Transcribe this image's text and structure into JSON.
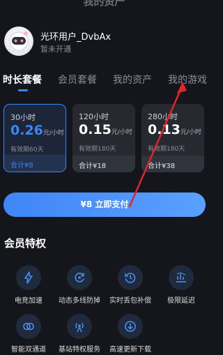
{
  "header": {
    "title": "我的资产"
  },
  "profile": {
    "name": "光环用户_DvbAx",
    "status": "暂未开通"
  },
  "tabs": [
    {
      "label": "时长套餐",
      "active": true
    },
    {
      "label": "会员套餐",
      "active": false
    },
    {
      "label": "我的资产",
      "active": false
    },
    {
      "label": "我的游戏",
      "active": false
    }
  ],
  "plans": [
    {
      "duration": "30小时",
      "price": "0.26",
      "unit": "元/小时",
      "validity": "有效期60天",
      "total": "合计¥8",
      "selected": true
    },
    {
      "duration": "120小时",
      "price": "0.15",
      "unit": "元/小时",
      "validity": "有效期180天",
      "total": "合计¥18",
      "selected": false
    },
    {
      "duration": "280小时",
      "price": "0.13",
      "unit": "元/小时",
      "validity": "有效期180天",
      "total": "合计¥38",
      "selected": false
    }
  ],
  "pay_button": {
    "label": "¥8 立即支付"
  },
  "perks_section": {
    "title": "会员特权",
    "items": [
      {
        "label": "电竞加速",
        "icon": "lightning-icon"
      },
      {
        "label": "动态多线防掉",
        "icon": "refresh-icon"
      },
      {
        "label": "实时丢包补偿",
        "icon": "clock-rewind-icon"
      },
      {
        "label": "极限延迟",
        "icon": "latency-chart-icon"
      },
      {
        "label": "智能双通道",
        "icon": "dual-channel-icon"
      },
      {
        "label": "基站特权服务",
        "icon": "signal-tower-icon"
      },
      {
        "label": "高速更新下载",
        "icon": "download-icon"
      }
    ]
  },
  "colors": {
    "accent": "#3a86ff",
    "background": "#14161b",
    "annotation_arrow": "#e0262a"
  }
}
